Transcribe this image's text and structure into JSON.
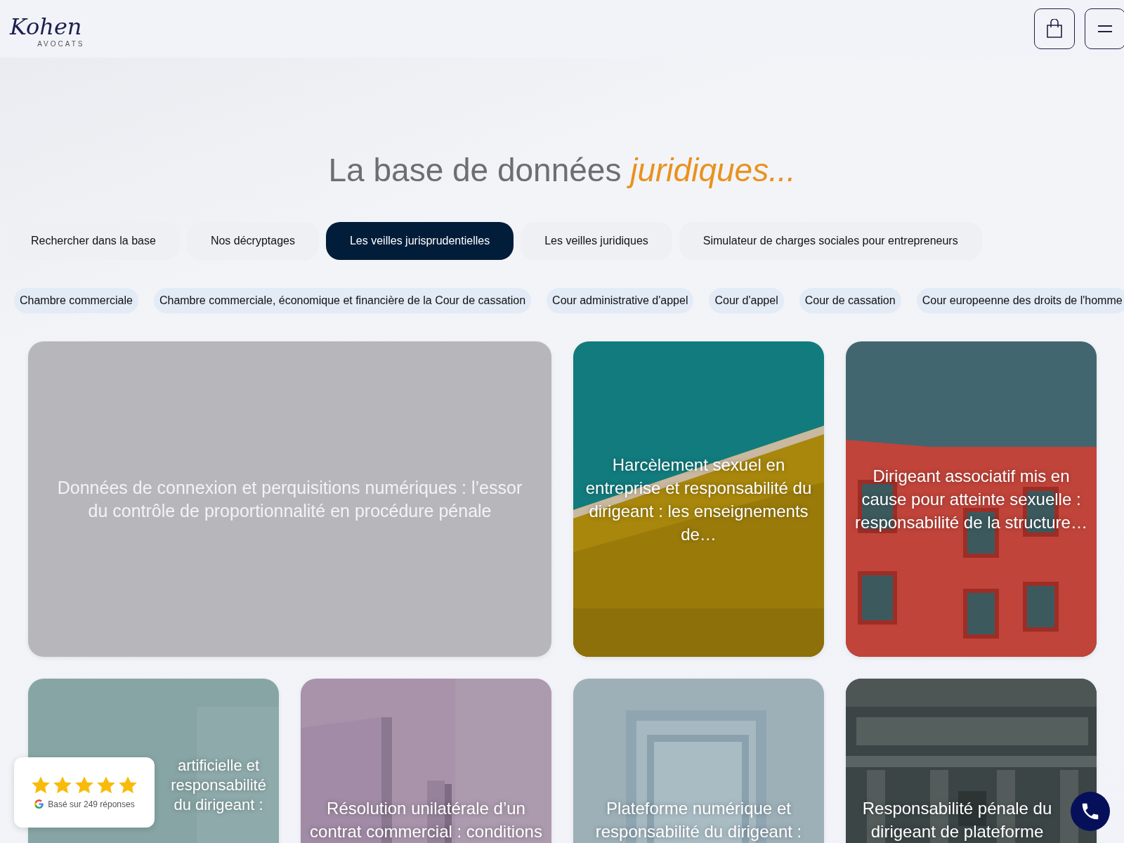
{
  "header": {
    "logo": "Kohen",
    "logo_sub": "AVOCATS"
  },
  "title": "La base de données *juridiques...*",
  "tabs": [
    {
      "label": "Rechercher dans la base",
      "selected": false
    },
    {
      "label": "Nos décryptages",
      "selected": false
    },
    {
      "label": "Les veilles jurisprudentielles",
      "selected": true
    },
    {
      "label": "Les veilles juridiques",
      "selected": false
    },
    {
      "label": "Simulateur de charges sociales pour entrepreneurs",
      "selected": false
    }
  ],
  "filters": [
    "Chambre commerciale",
    "Chambre commerciale, économique et financière de la Cour de cassation",
    "Cour administrative d'appel",
    "Cour d'appel",
    "Cour de cassation",
    "Cour europeenne des droits de l'homme"
  ],
  "articles": [
    {
      "title": "Données de connexion et perquisitions numériques : l’essor du contrôle de proportionnalité en procédure pénale",
      "kind": "plain"
    },
    {
      "title": "Harcèlement sexuel en entreprise et responsabilité du dirigeant : les enseignements de…",
      "kind": "picture"
    },
    {
      "title": "Dirigeant associatif mis en cause pour atteinte sexuelle : responsabilité de la structure…",
      "kind": "picture"
    },
    {
      "title": "artificielle et responsabilité du dirigeant :",
      "kind": "picture"
    },
    {
      "title": "Résolution unilatérale d’un contrat commercial : conditions",
      "kind": "picture"
    },
    {
      "title": "Plateforme numérique et responsabilité du dirigeant :",
      "kind": "picture"
    },
    {
      "title": "Responsabilité pénale du dirigeant de plateforme",
      "kind": "picture"
    }
  ],
  "rating": {
    "stars": 5,
    "text": "Basé sur 249 réponses"
  }
}
